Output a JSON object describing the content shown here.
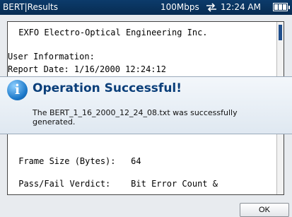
{
  "status_bar": {
    "title": "BERT|Results",
    "link_speed": "100Mbps",
    "network_icon": "network-arrows-icon",
    "time": "12:24 AM",
    "battery_icon": "battery-icon"
  },
  "report": {
    "lines": [
      " EXFO Electro-Optical Engineering Inc.",
      "User Information:",
      "Report Date: 1/16/2000 12:24:12",
      " Frame Size (Bytes):   64",
      " Pass/Fail Verdict:    Bit Error Count &"
    ]
  },
  "dialog": {
    "icon": "info-icon",
    "title": "Operation Successful!",
    "message": "The BERT_1_16_2000_12_24_08.txt was successfully generated."
  },
  "buttons": {
    "ok_label": "OK"
  },
  "colors": {
    "status_bar": "#0c3b6b",
    "dialog_title": "#0b3f7a",
    "info_icon": "#1b78c9"
  }
}
